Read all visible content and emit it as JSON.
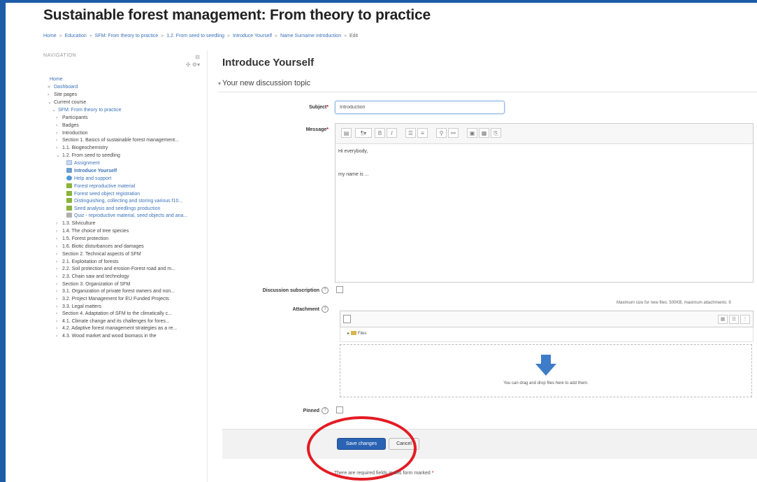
{
  "page_title": "Sustainable forest management: From theory to practice",
  "breadcrumb": [
    "Home",
    "Education",
    "SFM: From theory to practice",
    "1.2. From seed to seedling",
    "Introduce Yourself",
    "Name Surname introduction",
    "Edit"
  ],
  "sidebar": {
    "header": "NAVIGATION",
    "items": [
      {
        "m": "",
        "icon": "",
        "label": "Home",
        "style": "link"
      },
      {
        "m": "»",
        "icon": "",
        "label": "Dashboard",
        "style": "link",
        "indent": 1
      },
      {
        "m": "›",
        "icon": "",
        "label": "Site pages",
        "style": "",
        "indent": 1
      },
      {
        "m": "⌄",
        "icon": "",
        "label": "Current course",
        "style": "",
        "indent": 1
      },
      {
        "m": "⌄",
        "icon": "",
        "label": "SFM: From theory to practice",
        "style": "link",
        "indent": 2
      },
      {
        "m": "›",
        "icon": "",
        "label": "Participants",
        "style": "",
        "indent": 3
      },
      {
        "m": "›",
        "icon": "",
        "label": "Badges",
        "style": "",
        "indent": 3
      },
      {
        "m": "›",
        "icon": "",
        "label": "Introduction",
        "style": "",
        "indent": 3
      },
      {
        "m": "›",
        "icon": "",
        "label": "Section 1. Basics of sustainable forest management...",
        "style": "wrap",
        "indent": 3
      },
      {
        "m": "›",
        "icon": "",
        "label": "1.1. Biogeochemistry",
        "style": "",
        "indent": 3
      },
      {
        "m": "⌄",
        "icon": "",
        "label": "1.2. From seed to seedling",
        "style": "",
        "indent": 3
      },
      {
        "m": "",
        "icon": "assign",
        "label": "Assignment",
        "style": "link",
        "indent": 4
      },
      {
        "m": "",
        "icon": "blue",
        "label": "Introduce Yourself",
        "style": "bold",
        "indent": 4
      },
      {
        "m": "",
        "icon": "globe",
        "label": "Help and support",
        "style": "link",
        "indent": 4
      },
      {
        "m": "",
        "icon": "green",
        "label": "Forest reproductive material",
        "style": "link",
        "indent": 4
      },
      {
        "m": "",
        "icon": "green",
        "label": "Forest seed object registration",
        "style": "link",
        "indent": 4
      },
      {
        "m": "",
        "icon": "green",
        "label": "Distinguishing, collecting and storing various f10...",
        "style": "link wrap",
        "indent": 4
      },
      {
        "m": "",
        "icon": "green",
        "label": "Seed analysis and seedlings production",
        "style": "link",
        "indent": 4
      },
      {
        "m": "",
        "icon": "quiz",
        "label": "Quiz - reproductive material, seed objects and ana...",
        "style": "link wrap",
        "indent": 4
      },
      {
        "m": "›",
        "icon": "",
        "label": "1.3. Silviculture",
        "style": "",
        "indent": 3
      },
      {
        "m": "›",
        "icon": "",
        "label": "1.4. The choice of tree species",
        "style": "",
        "indent": 3
      },
      {
        "m": "›",
        "icon": "",
        "label": "1.5. Forest protection",
        "style": "",
        "indent": 3
      },
      {
        "m": "›",
        "icon": "",
        "label": "1.6. Biotic disturbances and damages",
        "style": "",
        "indent": 3
      },
      {
        "m": "›",
        "icon": "",
        "label": "Section 2. Technical aspects of SFM",
        "style": "",
        "indent": 3
      },
      {
        "m": "›",
        "icon": "",
        "label": "2.1. Exploitation of forests",
        "style": "",
        "indent": 3
      },
      {
        "m": "›",
        "icon": "",
        "label": "2.2. Soil protection and erosion-Forest road and m...",
        "style": "wrap",
        "indent": 3
      },
      {
        "m": "›",
        "icon": "",
        "label": "2.3. Chain saw and technology",
        "style": "",
        "indent": 3
      },
      {
        "m": "›",
        "icon": "",
        "label": "Section 3. Organization of SFM",
        "style": "",
        "indent": 3
      },
      {
        "m": "›",
        "icon": "",
        "label": "3.1. Organization of private forest owners and non...",
        "style": "wrap",
        "indent": 3
      },
      {
        "m": "›",
        "icon": "",
        "label": "3.2. Project Management for EU Funded Projects",
        "style": "",
        "indent": 3
      },
      {
        "m": "›",
        "icon": "",
        "label": "3.3. Legal matters",
        "style": "",
        "indent": 3
      },
      {
        "m": "›",
        "icon": "",
        "label": "Section 4. Adaptation of SFM to the climatically c...",
        "style": "wrap",
        "indent": 3
      },
      {
        "m": "›",
        "icon": "",
        "label": "4.1. Climate change and its challenges for fores...",
        "style": "",
        "indent": 3
      },
      {
        "m": "›",
        "icon": "",
        "label": "4.2. Adaptive forest management strategies as a re...",
        "style": "wrap",
        "indent": 3
      },
      {
        "m": "›",
        "icon": "",
        "label": "4.3. Wood market and wood biomass in the",
        "style": "",
        "indent": 3
      }
    ]
  },
  "main": {
    "heading": "Introduce Yourself",
    "legend": "Your new discussion topic",
    "subject_label": "Subject",
    "subject_value": "Introduction",
    "message_label": "Message",
    "message_lines": [
      "Hi everybody,",
      "",
      "",
      "my name is ..."
    ],
    "subscription_label": "Discussion subscription",
    "attachment_label": "Attachment",
    "maxsize_text": "Maximum size for new files: 500KB, maximum attachments: 9",
    "files_label": "Files",
    "drop_text": "You can drag and drop files here to add them.",
    "pinned_label": "Pinned",
    "save_label": "Save changes",
    "cancel_label": "Cancel",
    "required_note": "There are required fields in this form marked"
  },
  "colors": {
    "primary_button": "#2a63b3",
    "highlight_ring": "#e31b23",
    "link": "#3a72b8"
  }
}
